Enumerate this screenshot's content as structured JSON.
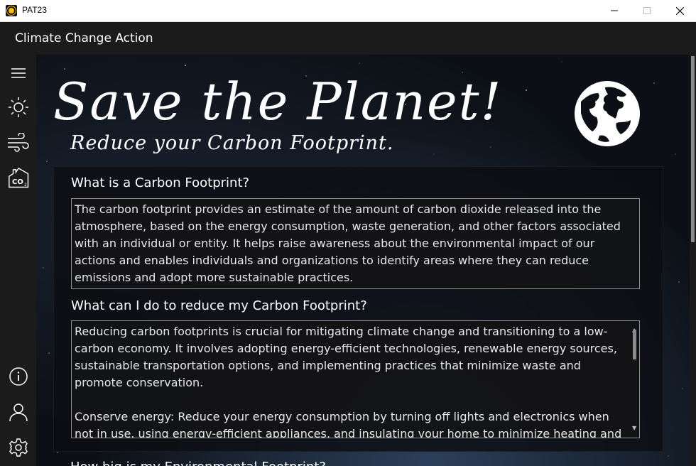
{
  "window": {
    "title": "PAT23",
    "icons": {
      "minimize": "minimize-icon",
      "maximize": "maximize-icon",
      "close": "close-icon"
    }
  },
  "header": {
    "title": "Climate Change Action"
  },
  "sidebar": {
    "items": [
      {
        "icon": "hamburger-menu-icon"
      },
      {
        "icon": "sun-icon"
      },
      {
        "icon": "wind-icon"
      },
      {
        "icon": "co2-icon"
      },
      {
        "icon": "info-icon"
      },
      {
        "icon": "user-icon"
      },
      {
        "icon": "settings-gear-icon"
      }
    ]
  },
  "hero": {
    "title": "Save the Planet!",
    "subtitle": "Reduce your Carbon Footprint.",
    "icon": "globe-icon"
  },
  "sections": [
    {
      "heading": "What is a Carbon Footprint?",
      "body": "The carbon footprint provides an estimate of the amount of carbon dioxide released into the atmosphere, based on the energy consumption, waste generation, and other factors associated with an individual or entity. It helps raise awareness about the environmental impact of our actions and enables individuals and organizations to identify areas where they can reduce emissions and adopt more sustainable practices."
    },
    {
      "heading": "What can I do to reduce my Carbon Footprint?",
      "body": "Reducing carbon footprints is crucial for mitigating climate change and transitioning to a low-carbon economy. It involves adopting energy-efficient technologies, renewable energy sources, sustainable transportation options, and implementing practices that minimize waste and promote conservation.\n\nConserve energy: Reduce your energy consumption by turning off lights and electronics when not in use, using energy-efficient appliances, and insulating your home to minimize heating and"
    },
    {
      "heading": "How big is my Environmental Footprint?"
    }
  ]
}
